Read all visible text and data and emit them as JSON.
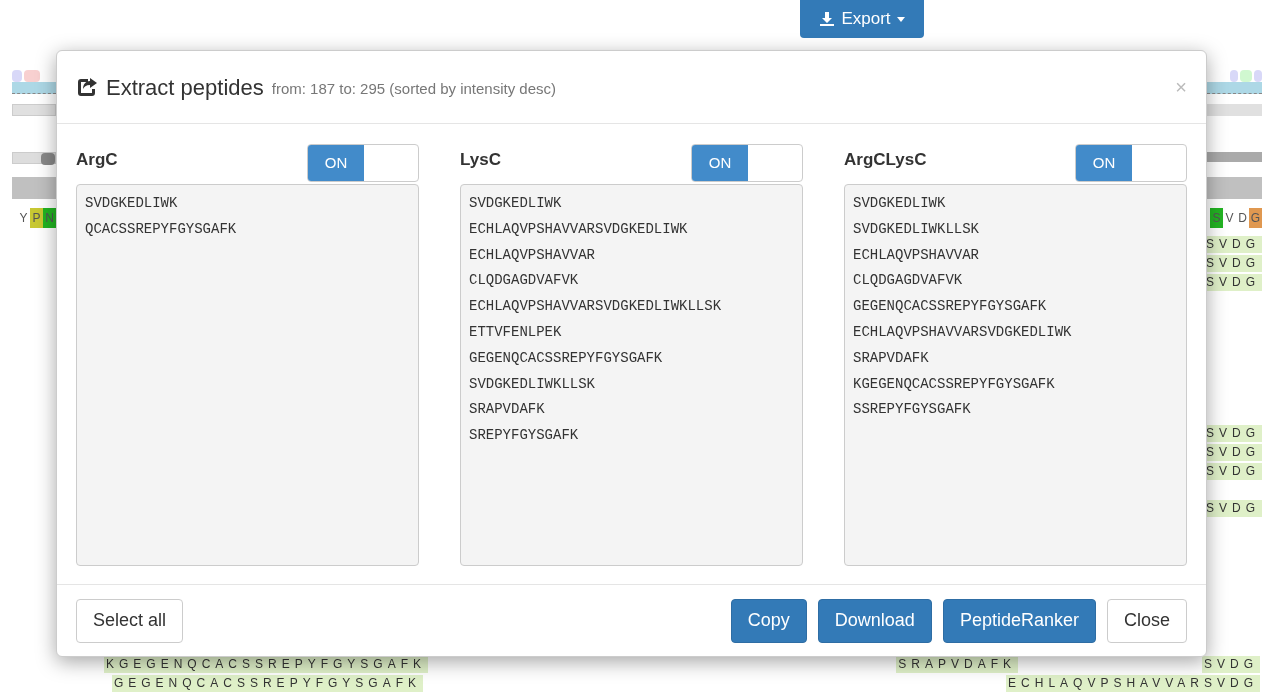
{
  "export_button": {
    "label": "Export"
  },
  "sequence_view": {
    "left_residues": [
      {
        "letter": "Y",
        "color": "#ffffff"
      },
      {
        "letter": "P",
        "color": "#c8c832"
      },
      {
        "letter": "N",
        "color": "#22b422"
      }
    ],
    "right_residues": [
      {
        "letter": "S",
        "color": "#22b422"
      },
      {
        "letter": "V",
        "color": "#ffffff"
      },
      {
        "letter": "D",
        "color": "#ffffff"
      },
      {
        "letter": "G",
        "color": "#e09850"
      }
    ],
    "right_peptides_top": [
      "SVDG",
      "SVDG",
      "SVDG"
    ],
    "right_peptides_mid": [
      "SVDG",
      "SVDG",
      "SVDG"
    ],
    "right_peptides_low": [
      "SVDG"
    ],
    "bottom_rows": [
      {
        "left": "KGEGENQCACSSREPYFGYSGAFK",
        "middle": "SRAPVDAFK",
        "right": "SVDG"
      },
      {
        "left": "GEGENQCACSSREPYFGYSGAFK",
        "right": "ECHLAQVPSHAVVARSVDG"
      }
    ]
  },
  "modal": {
    "title": "Extract peptides",
    "subtitle": "from: 187 to: 295 (sorted by intensity desc)",
    "close": "×",
    "panels": [
      {
        "name": "ArgC",
        "toggle": {
          "label": "ON",
          "on": true
        },
        "peptides": [
          "SVDGKEDLIWK",
          "QCACSSREPYFGYSGAFK"
        ]
      },
      {
        "name": "LysC",
        "toggle": {
          "label": "ON",
          "on": true
        },
        "peptides": [
          "SVDGKEDLIWK",
          "ECHLAQVPSHAVVARSVDGKEDLIWK",
          "ECHLAQVPSHAVVAR",
          "CLQDGAGDVAFVK",
          "ECHLAQVPSHAVVARSVDGKEDLIWKLLSK",
          "ETTVFENLPEK",
          "GEGENQCACSSREPYFGYSGAFK",
          "SVDGKEDLIWKLLSK",
          "SRAPVDAFK",
          "SREPYFGYSGAFK"
        ]
      },
      {
        "name": "ArgCLysC",
        "toggle": {
          "label": "ON",
          "on": true
        },
        "peptides": [
          "SVDGKEDLIWK",
          "SVDGKEDLIWKLLSK",
          "ECHLAQVPSHAVVAR",
          "CLQDGAGDVAFVK",
          "GEGENQCACSSREPYFGYSGAFK",
          "ECHLAQVPSHAVVARSVDGKEDLIWK",
          "SRAPVDAFK",
          "KGEGENQCACSSREPYFGYSGAFK",
          "SSREPYFGYSGAFK"
        ]
      }
    ],
    "footer_left": [
      {
        "label": "Select all",
        "kind": "default"
      }
    ],
    "footer_right": [
      {
        "label": "Copy",
        "kind": "primary"
      },
      {
        "label": "Download",
        "kind": "primary"
      },
      {
        "label": "PeptideRanker",
        "kind": "primary"
      },
      {
        "label": "Close",
        "kind": "default"
      }
    ]
  }
}
